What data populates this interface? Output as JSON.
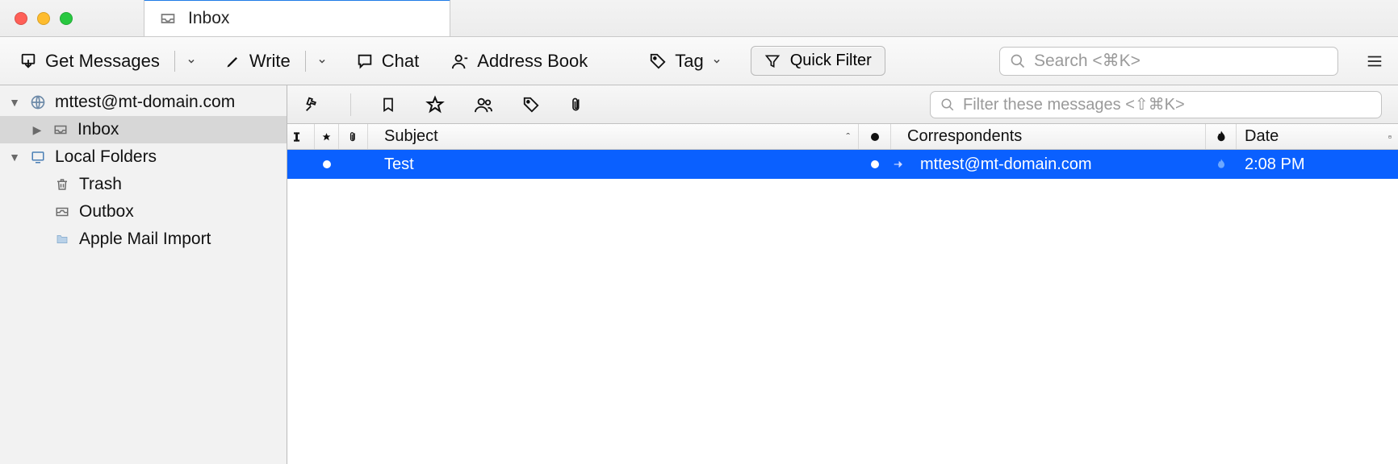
{
  "tab": {
    "title": "Inbox"
  },
  "toolbar": {
    "get_messages": "Get Messages",
    "write": "Write",
    "chat": "Chat",
    "address_book": "Address Book",
    "tag": "Tag",
    "quick_filter": "Quick Filter",
    "search_placeholder": "Search <⌘K>"
  },
  "sidebar": {
    "account": "mttest@mt-domain.com",
    "inbox": "Inbox",
    "local_folders": "Local Folders",
    "trash": "Trash",
    "outbox": "Outbox",
    "apple_import": "Apple Mail Import"
  },
  "filter_placeholder": "Filter these messages <⇧⌘K>",
  "columns": {
    "subject": "Subject",
    "correspondents": "Correspondents",
    "date": "Date"
  },
  "messages": [
    {
      "subject": "Test",
      "correspondent": "mttest@mt-domain.com",
      "date": "2:08 PM",
      "unread": true,
      "selected": true
    }
  ]
}
